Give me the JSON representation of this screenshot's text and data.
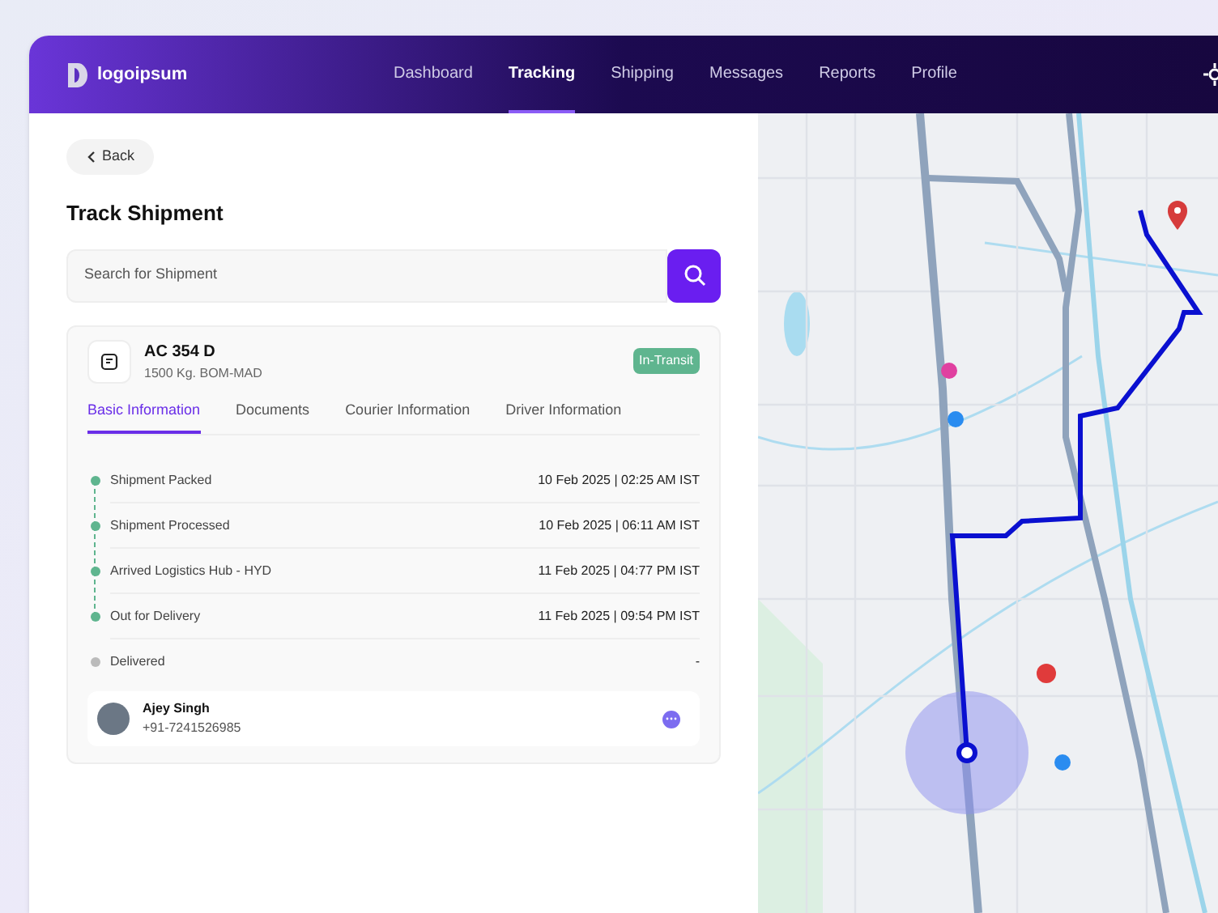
{
  "brand": "logoipsum",
  "nav": [
    {
      "label": "Dashboard",
      "selected": false
    },
    {
      "label": "Tracking",
      "selected": true
    },
    {
      "label": "Shipping",
      "selected": false
    },
    {
      "label": "Messages",
      "selected": false
    },
    {
      "label": "Reports",
      "selected": false
    },
    {
      "label": "Profile",
      "selected": false
    }
  ],
  "back_button": "Back",
  "page_title": "Track Shipment",
  "search": {
    "placeholder": "Search for Shipment"
  },
  "shipment": {
    "id": "AC 354 D",
    "details": "1500 Kg. BOM-MAD",
    "status": "In-Transit"
  },
  "tabs": [
    {
      "label": "Basic Information",
      "selected": true
    },
    {
      "label": "Documents",
      "selected": false
    },
    {
      "label": "Courier Information",
      "selected": false
    },
    {
      "label": "Driver Information",
      "selected": false
    }
  ],
  "timeline": [
    {
      "label": "Shipment Packed",
      "time": "10 Feb 2025 | 02:25 AM IST",
      "done": true
    },
    {
      "label": "Shipment Processed",
      "time": "10 Feb 2025 | 06:11 AM IST",
      "done": true
    },
    {
      "label": "Arrived Logistics Hub - HYD",
      "time": "11 Feb 2025 | 04:77 PM IST",
      "done": true
    },
    {
      "label": "Out for Delivery",
      "time": "11 Feb 2025 | 09:54 PM IST",
      "done": true
    },
    {
      "label": "Delivered",
      "time": "-",
      "done": false
    }
  ],
  "driver": {
    "name": "Ajey Singh",
    "phone": "+91-7241526985"
  }
}
